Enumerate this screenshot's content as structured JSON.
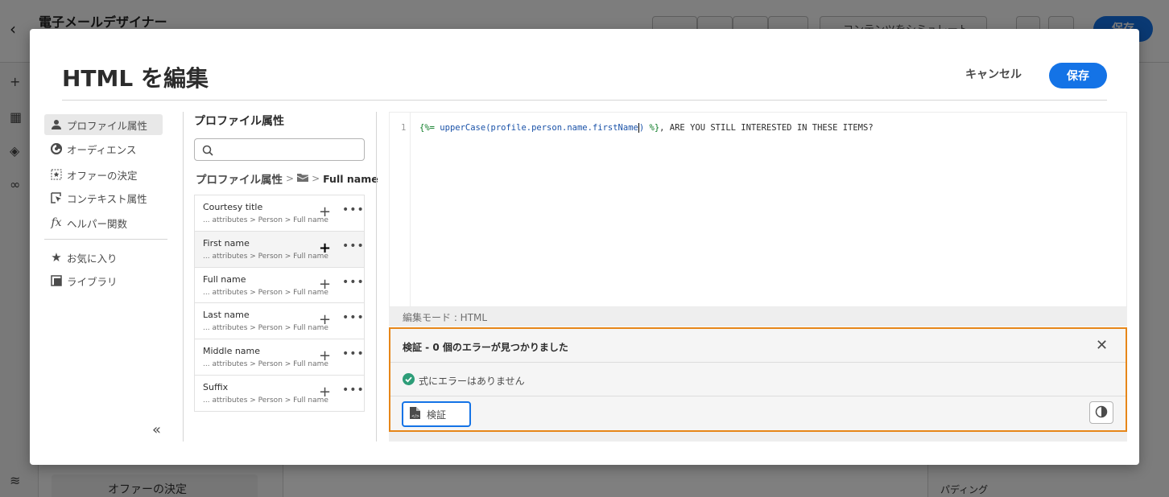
{
  "background": {
    "app_title": "電子メールデザイナー",
    "simulate_label": "コンテンツをシミュレート",
    "save_label": "保存",
    "offer_label": "オファーの決定",
    "padding_label": "パディング"
  },
  "modal": {
    "title": "HTML を編集",
    "cancel_label": "キャンセル",
    "save_label": "保存"
  },
  "categories": [
    {
      "label": "プロファイル属性",
      "icon": "person-icon",
      "selected": true
    },
    {
      "label": "オーディエンス",
      "icon": "audience-icon",
      "selected": false
    },
    {
      "label": "オファーの決定",
      "icon": "offer-icon",
      "selected": false
    },
    {
      "label": "コンテキスト属性",
      "icon": "context-icon",
      "selected": false
    },
    {
      "label": "ヘルパー関数",
      "icon": "function-icon",
      "selected": false
    },
    {
      "label": "お気に入り",
      "icon": "star-icon",
      "selected": false
    },
    {
      "label": "ライブラリ",
      "icon": "library-icon",
      "selected": false
    }
  ],
  "browser": {
    "heading": "プロファイル属性",
    "search_placeholder": "",
    "breadcrumb": {
      "root": "プロファイル属性",
      "separator": ">",
      "current": "Full name"
    },
    "items": [
      {
        "name": "Courtesy title",
        "path": "... attributes > Person > Full name"
      },
      {
        "name": "First name",
        "path": "... attributes > Person > Full name"
      },
      {
        "name": "Full name",
        "path": "... attributes > Person > Full name"
      },
      {
        "name": "Last name",
        "path": "... attributes > Person > Full name"
      },
      {
        "name": "Middle name",
        "path": "... attributes > Person > Full name"
      },
      {
        "name": "Suffix",
        "path": "... attributes > Person > Full name"
      }
    ]
  },
  "editor": {
    "line_number": "1",
    "code_delim_open": "{%= ",
    "code_func": "upperCase(profile.person.name.firstName",
    "code_paren": ")",
    "code_delim_close": " %}",
    "code_rest": ", ARE YOU STILL INTERESTED IN THESE ITEMS?",
    "mode_label": "編集モード : HTML"
  },
  "validation": {
    "title": "検証 - 0 個のエラーが見つかりました",
    "message": "式にエラーはありません",
    "validate_button": "検証",
    "highlight_color": "#e68619",
    "success_color": "#2d9d78"
  },
  "colors": {
    "accent": "#1473e6"
  }
}
